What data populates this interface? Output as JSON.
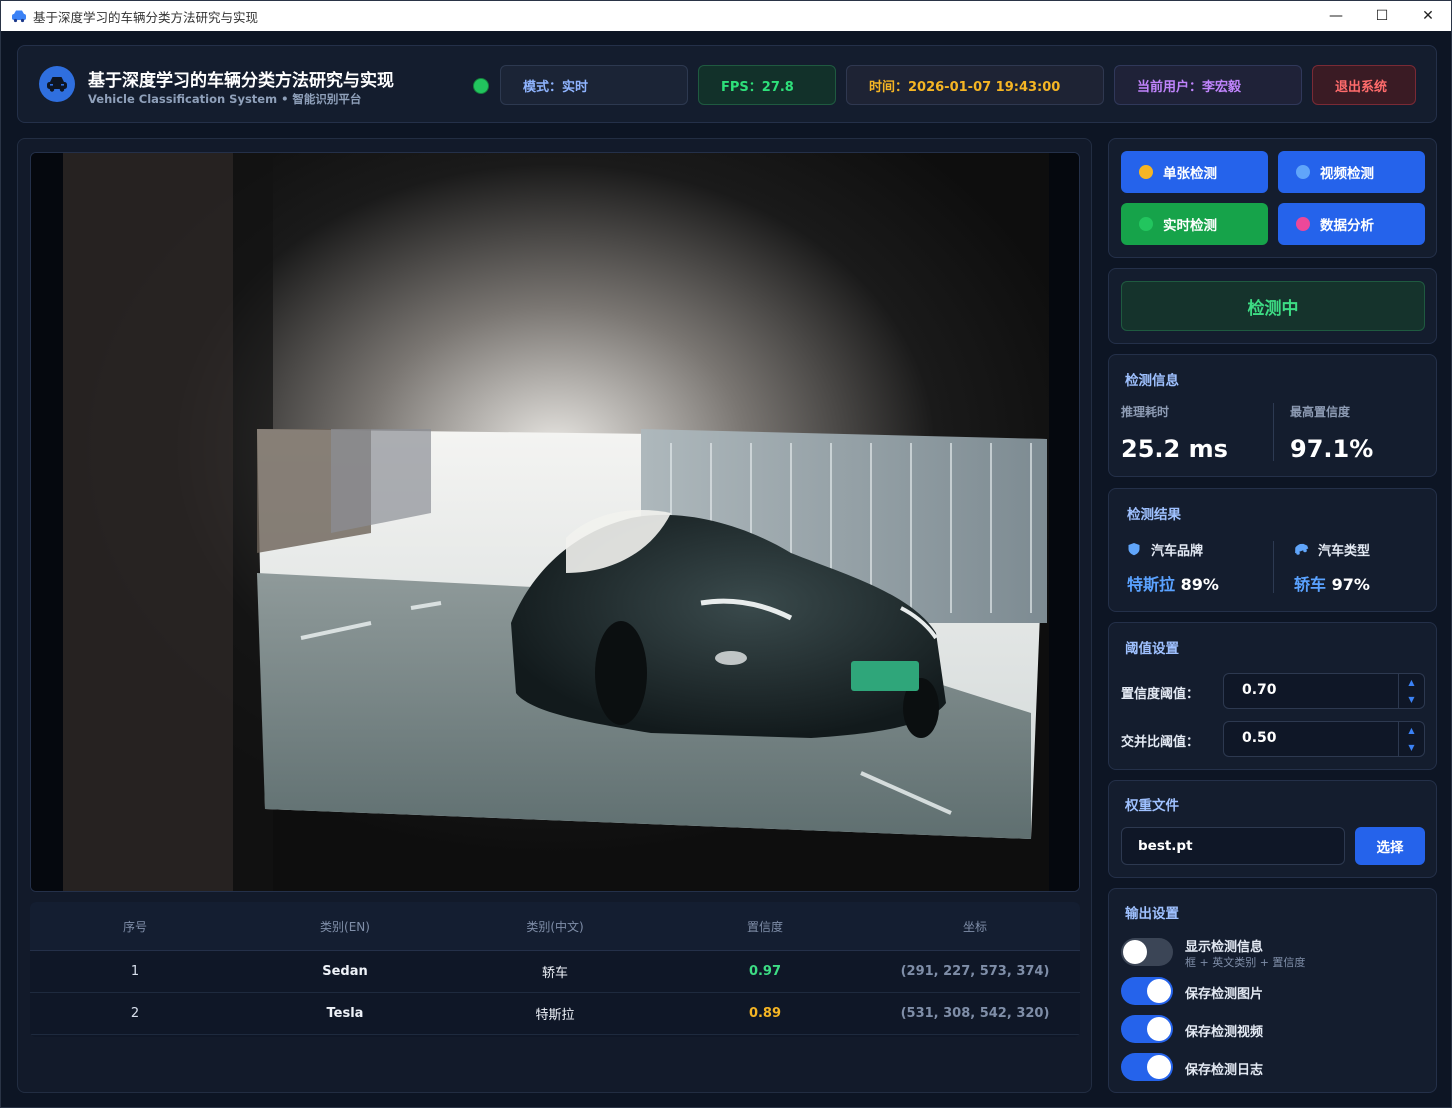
{
  "window": {
    "title": "基于深度学习的车辆分类方法研究与实现",
    "controls": {
      "minimize": "—",
      "maximize": "☐",
      "close": "✕"
    }
  },
  "header": {
    "title": "基于深度学习的车辆分类方法研究与实现",
    "subtitle": "Vehicle Classification System • 智能识别平台",
    "status_color": "#22c55e",
    "mode": "模式：实时",
    "fps": "FPS：27.8",
    "time": "时间：2026-01-07 19:43:00",
    "user": "当前用户：李宏毅",
    "logout": "退出系统"
  },
  "modes": [
    {
      "label": "单张检测",
      "dot_color": "#f5b524",
      "style": "blue"
    },
    {
      "label": "视频检测",
      "dot_color": "#60a5fa",
      "style": "blue"
    },
    {
      "label": "实时检测",
      "dot_color": "#22c55e",
      "style": "green"
    },
    {
      "label": "数据分析",
      "dot_color": "#ec4899",
      "style": "blue"
    }
  ],
  "detect_state": "检测中",
  "detect_info": {
    "title": "检测信息",
    "latency_label": "推理耗时",
    "latency_value": "25.2 ms",
    "max_conf_label": "最高置信度",
    "max_conf_value": "97.1%"
  },
  "detect_result": {
    "title": "检测结果",
    "brand_label": "汽车品牌",
    "brand_name": "特斯拉",
    "brand_pct": "89%",
    "type_label": "汽车类型",
    "type_name": "轿车",
    "type_pct": "97%"
  },
  "threshold": {
    "title": "阈值设置",
    "conf_label": "置信度阈值：",
    "conf_value": "0.70",
    "iou_label": "交并比阈值：",
    "iou_value": "0.50"
  },
  "weights": {
    "title": "权重文件",
    "file": "best.pt",
    "choose": "选择"
  },
  "output": {
    "title": "输出设置",
    "items": [
      {
        "label": "显示检测信息",
        "sub": "框 + 英文类别 + 置信度",
        "on": false
      },
      {
        "label": "保存检测图片",
        "sub": "",
        "on": true
      },
      {
        "label": "保存检测视频",
        "sub": "",
        "on": true
      },
      {
        "label": "保存检测日志",
        "sub": "",
        "on": true
      }
    ]
  },
  "table": {
    "headers": [
      "序号",
      "类别(EN)",
      "类别(中文)",
      "置信度",
      "坐标"
    ],
    "rows": [
      {
        "idx": "1",
        "en": "Sedan",
        "zh": "轿车",
        "conf": "0.97",
        "conf_color": "#3ddc84",
        "coord": "(291, 227, 573, 374)"
      },
      {
        "idx": "2",
        "en": "Tesla",
        "zh": "特斯拉",
        "conf": "0.89",
        "conf_color": "#f5b524",
        "coord": "(531, 308, 542, 320)"
      }
    ]
  }
}
